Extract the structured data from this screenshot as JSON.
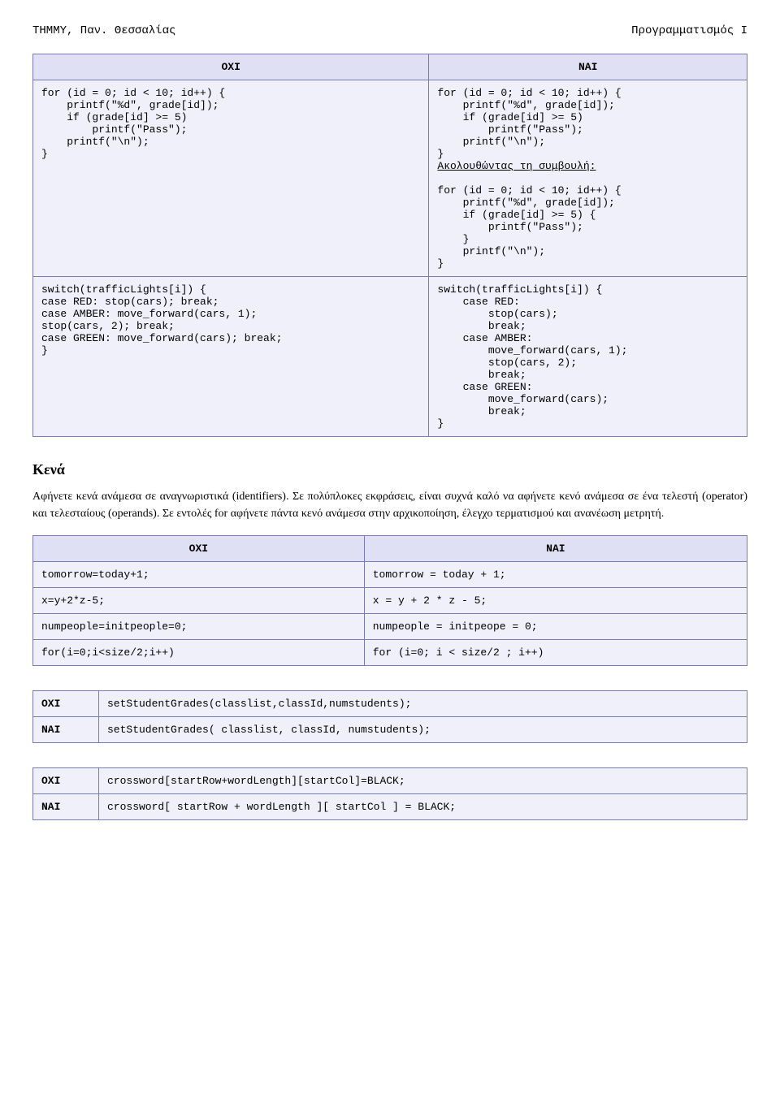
{
  "header": {
    "left": "ΤΗΜΜΥ, Παν. Θεσσαλίας",
    "right": "Προγραμματισμός Ι"
  },
  "table1": {
    "col_oxi": "ΟΧΙ",
    "col_nai": "ΝΑΙ",
    "row1_left": "for (id = 0; id < 10; id++) {\n    printf(\"%d\", grade[id]);\n    if (grade[id] >= 5)\n        printf(\"Pass\");\n    printf(\"\\n\");\n}",
    "row1_right_a": "for (id = 0; id < 10; id++) {\n    printf(\"%d\", grade[id]);\n    if (grade[id] >= 5)\n        printf(\"Pass\");\n    printf(\"\\n\");\n}",
    "row1_right_advice": "Ακολουθώντας τη συμβουλή:",
    "row1_right_b": "for (id = 0; id < 10; id++) {\n    printf(\"%d\", grade[id]);\n    if (grade[id] >= 5) {\n        printf(\"Pass\");\n    }\n    printf(\"\\n\");\n}",
    "row2_left": "switch(trafficLights[i]) {\ncase RED: stop(cars); break;\ncase AMBER: move_forward(cars, 1);\nstop(cars, 2); break;\ncase GREEN: move_forward(cars); break;\n}",
    "row2_right": "switch(trafficLights[i]) {\n    case RED:\n        stop(cars);\n        break;\n    case AMBER:\n        move_forward(cars, 1);\n        stop(cars, 2);\n        break;\n    case GREEN:\n        move_forward(cars);\n        break;\n}"
  },
  "section_kena_title": "Κενά",
  "section_kena_para": "Αφήνετε κενά ανάμεσα σε αναγνωριστικά (identifiers). Σε πολύπλοκες εκφράσεις, είναι συχνά καλό να αφήνετε κενό ανάμεσα σε ένα τελεστή (operator) και τελεσταίους (operands). Σε εντολές for αφήνετε πάντα κενό ανάμεσα στην αρχικοποίηση, έλεγχο τερματισμού και ανανέωση μετρητή.",
  "table2": {
    "col_oxi": "ΟΧΙ",
    "col_nai": "ΝΑΙ",
    "rows": [
      {
        "left": "tomorrow=today+1;",
        "right": "tomorrow = today + 1;"
      },
      {
        "left": "x=y+2*z-5;",
        "right": "x = y + 2 * z - 5;"
      },
      {
        "left": "numpeople=initpeople=0;",
        "right": "numpeople = initpeope = 0;"
      },
      {
        "left": "for(i=0;i<size/2;i++)",
        "right": "for (i=0; i < size/2 ; i++)"
      }
    ]
  },
  "table3": {
    "oxi_label": "ΟΧΙ",
    "nai_label": "ΝΑΙ",
    "oxi_code": "setStudentGrades(classlist,classId,numstudents);",
    "nai_code": "setStudentGrades( classlist, classId, numstudents);"
  },
  "table4": {
    "oxi_label": "ΟΧΙ",
    "nai_label": "ΝΑΙ",
    "oxi_code": "crossword[startRow+wordLength][startCol]=BLACK;",
    "nai_code": "crossword[ startRow + wordLength ][ startCol ] = BLACK;"
  }
}
